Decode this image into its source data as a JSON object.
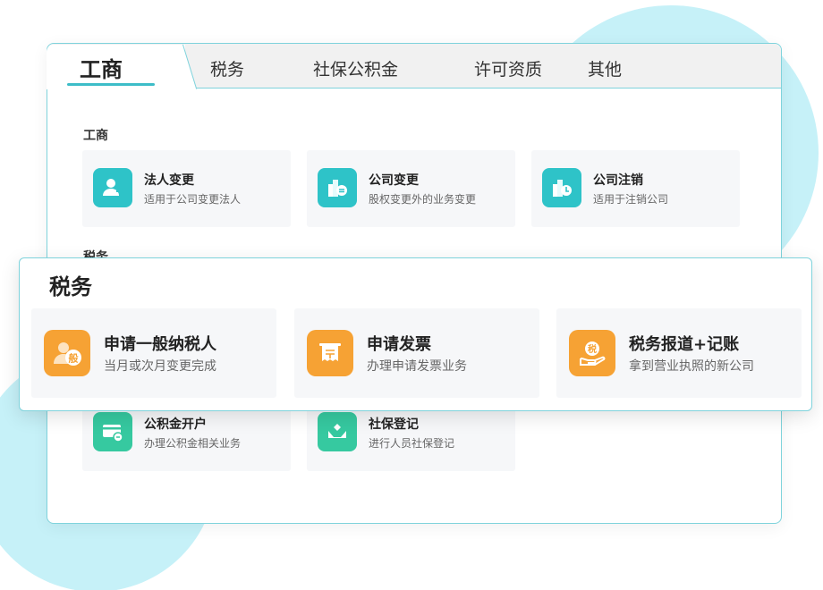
{
  "tabs": [
    {
      "label": "工商",
      "active": true
    },
    {
      "label": "税务",
      "active": false
    },
    {
      "label": "社保公积金",
      "active": false
    },
    {
      "label": "许可资质",
      "active": false
    },
    {
      "label": "其他",
      "active": false
    }
  ],
  "sections": {
    "gongshang": {
      "title": "工商",
      "items": [
        {
          "title": "法人变更",
          "desc": "适用于公司变更法人",
          "icon": "user-change-icon"
        },
        {
          "title": "公司变更",
          "desc": "股权变更外的业务变更",
          "icon": "building-change-icon"
        },
        {
          "title": "公司注销",
          "desc": "适用于注销公司",
          "icon": "building-cancel-icon"
        }
      ]
    },
    "shuiwu_hidden": {
      "title": "税务"
    },
    "shebao": {
      "items": [
        {
          "title": "公积金开户",
          "desc": "办理公积金相关业务",
          "icon": "card-icon"
        },
        {
          "title": "社保登记",
          "desc": "进行人员社保登记",
          "icon": "hands-heart-icon"
        }
      ]
    }
  },
  "overlay": {
    "title": "税务",
    "items": [
      {
        "title": "申请一般纳税人",
        "desc": "当月或次月变更完成",
        "icon": "general-taxpayer-icon",
        "badge": "般"
      },
      {
        "title": "申请发票",
        "desc": "办理申请发票业务",
        "icon": "invoice-icon"
      },
      {
        "title": "税务报道+记账",
        "desc": "拿到营业执照的新公司",
        "icon": "tax-report-icon",
        "badge": "税"
      }
    ]
  },
  "colors": {
    "accent": "#3dbdc8",
    "teal": "#2ec3c8",
    "green": "#36c9a0",
    "orange": "#f6a234",
    "blob": "#c6f1f8"
  }
}
